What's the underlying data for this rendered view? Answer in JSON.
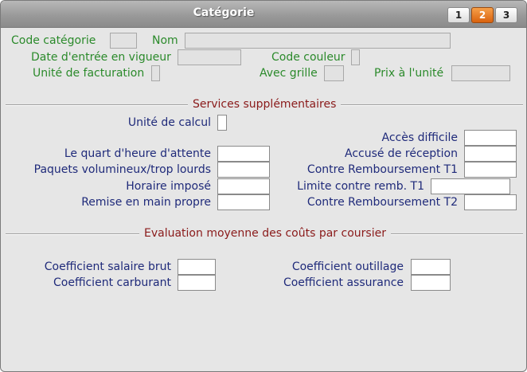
{
  "window": {
    "title": "Catégorie"
  },
  "tabs": [
    {
      "label": "1"
    },
    {
      "label": "2"
    },
    {
      "label": "3"
    }
  ],
  "header": {
    "code_categorie": "Code catégorie",
    "nom": "Nom",
    "date_entree": "Date d'entrée en vigueur",
    "code_couleur": "Code couleur",
    "unite_facturation": "Unité de facturation",
    "avec_grille": "Avec grille",
    "prix_unite": "Prix à l'unité"
  },
  "services": {
    "section_title": "Services supplémentaires",
    "unite_calcul": "Unité de calcul",
    "acces_difficile": "Accès difficile",
    "quart_heure": "Le quart d'heure d'attente",
    "accuse_reception": "Accusé de réception",
    "paquets": "Paquets volumineux/trop lourds",
    "contre_remb_t1": "Contre Remboursement T1",
    "horaire_impose": "Horaire imposé",
    "limite_remb_t1": "Limite contre remb. T1",
    "remise_main": "Remise en main propre",
    "contre_remb_t2": "Contre Remboursement T2"
  },
  "evaluation": {
    "section_title": "Evaluation moyenne des coûts par coursier",
    "coef_salaire": "Coefficient salaire brut",
    "coef_outillage": "Coefficient outillage",
    "coef_carburant": "Coefficient carburant",
    "coef_assurance": "Coefficient assurance"
  },
  "colors": {
    "label_green": "#2b8a2b",
    "label_blue": "#1f2a7a",
    "section_red": "#8a1a1a",
    "active_tab": "#e0761c"
  }
}
